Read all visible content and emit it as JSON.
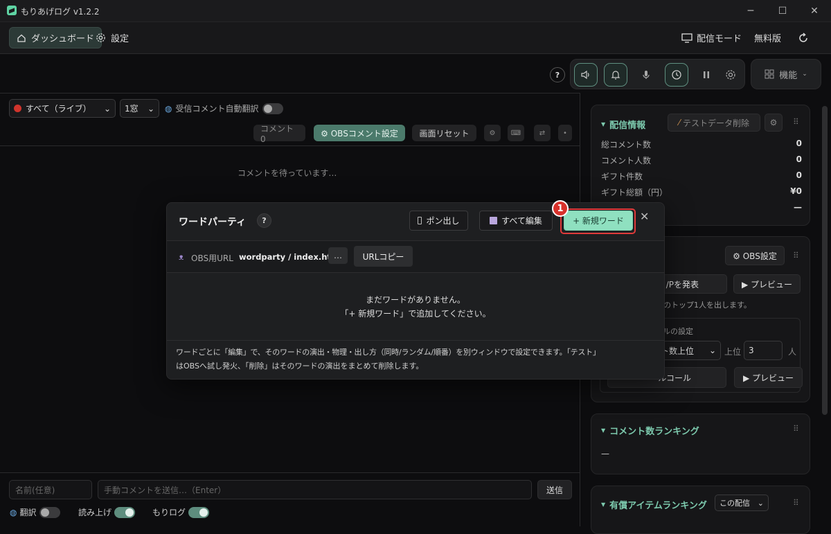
{
  "app": {
    "title": "もりあげログ v1.2.2"
  },
  "nav": {
    "dashboard": "ダッシュボード",
    "settings": "設定",
    "stream_mode": "配信モード",
    "plan": "無料版"
  },
  "toolbar": {
    "help": "?",
    "feature": "機能"
  },
  "left": {
    "source_select": "すべて（ライブ）",
    "window_select": "1窓",
    "auto_translate": "受信コメント自動翻訳",
    "comment_count": "コメント 0",
    "obs_comment_settings": "⚙ OBSコメント設定",
    "reset_screen": "画面リセット",
    "waiting": "コメントを待っています…"
  },
  "bottom": {
    "name_placeholder": "名前(任意)",
    "comment_placeholder": "手動コメントを送信…（Enter）",
    "send": "送信",
    "translate": "翻訳",
    "read_aloud": "読み上げ",
    "morilog": "もりログ"
  },
  "right": {
    "stream_info": {
      "title": "配信情報",
      "delete_test": "テストデータ削除",
      "stats": [
        {
          "label": "総コメント数",
          "value": "0"
        },
        {
          "label": "コメント人数",
          "value": "0"
        },
        {
          "label": "ギフト件数",
          "value": "0"
        },
        {
          "label": "ギフト総額（円）",
          "value": "¥0"
        },
        {
          "label": "",
          "value": "—"
        }
      ]
    },
    "mvp": {
      "obs_settings": "⚙ OBS設定",
      "announce": "/Pを発表",
      "preview1": "▶ プレビュー",
      "desc": "のトップ1人を出します。",
      "settings_label": "ルの設定",
      "rank_select": "ト数上位",
      "top_label": "上位",
      "top_value": "3",
      "unit": "人",
      "call": "ルコール",
      "preview2": "▶ プレビュー"
    },
    "comment_ranking": {
      "title": "コメント数ランキング",
      "value": "—"
    },
    "paid_ranking": {
      "title": "有償アイテムランキング",
      "select": "この配信"
    }
  },
  "modal": {
    "title": "ワードパーティ",
    "help": "?",
    "pon_button": "ポン出し",
    "edit_all": "すべて編集",
    "new_word": "+ 新規ワード",
    "obs_url_label": "OBS用URL",
    "url_value": "wordparty / index.html",
    "more": "…",
    "copy_url": "URLコピー",
    "empty_line1": "まだワードがありません。",
    "empty_line2": "「+ 新規ワード」で追加してください。",
    "footer_line1": "ワードごとに「編集」で、そのワードの演出・物理・出し方（同時/ランダム/順番）を別ウィンドウで設定できます。「テスト」",
    "footer_line2": "はOBSへ試し発火、「削除」はそのワードの演出をまとめて削除します。"
  },
  "annotation": {
    "badge": "1"
  },
  "colors": {
    "accent": "#8fe0c0",
    "highlight": "#e03a3a",
    "background": "#0d0d0f"
  }
}
